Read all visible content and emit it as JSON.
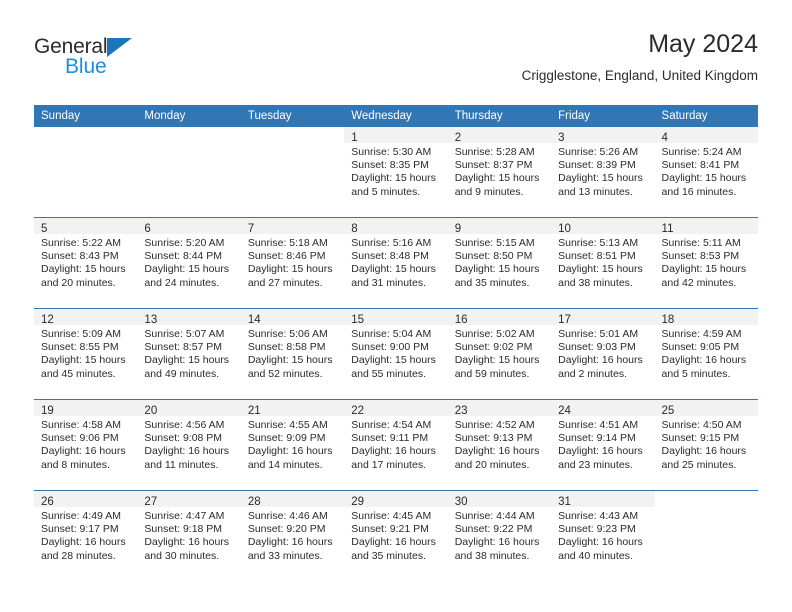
{
  "brand": {
    "name_top": "General",
    "name_bottom": "Blue",
    "triangle_color": "#1b75bb",
    "blue_text_color": "#1b8ede"
  },
  "header": {
    "month_title": "May 2024",
    "location": "Crigglestone, England, United Kingdom"
  },
  "theme": {
    "header_blue": "#3176b5",
    "daynum_band": "#f2f2f2",
    "text": "#2b2b2b"
  },
  "weekday_headers": [
    "Sunday",
    "Monday",
    "Tuesday",
    "Wednesday",
    "Thursday",
    "Friday",
    "Saturday"
  ],
  "weeks": [
    [
      {
        "day": "",
        "sunrise": "",
        "sunset": "",
        "daylight_a": "",
        "daylight_b": ""
      },
      {
        "day": "",
        "sunrise": "",
        "sunset": "",
        "daylight_a": "",
        "daylight_b": ""
      },
      {
        "day": "",
        "sunrise": "",
        "sunset": "",
        "daylight_a": "",
        "daylight_b": ""
      },
      {
        "day": "1",
        "sunrise": "Sunrise: 5:30 AM",
        "sunset": "Sunset: 8:35 PM",
        "daylight_a": "Daylight: 15 hours",
        "daylight_b": "and 5 minutes."
      },
      {
        "day": "2",
        "sunrise": "Sunrise: 5:28 AM",
        "sunset": "Sunset: 8:37 PM",
        "daylight_a": "Daylight: 15 hours",
        "daylight_b": "and 9 minutes."
      },
      {
        "day": "3",
        "sunrise": "Sunrise: 5:26 AM",
        "sunset": "Sunset: 8:39 PM",
        "daylight_a": "Daylight: 15 hours",
        "daylight_b": "and 13 minutes."
      },
      {
        "day": "4",
        "sunrise": "Sunrise: 5:24 AM",
        "sunset": "Sunset: 8:41 PM",
        "daylight_a": "Daylight: 15 hours",
        "daylight_b": "and 16 minutes."
      }
    ],
    [
      {
        "day": "5",
        "sunrise": "Sunrise: 5:22 AM",
        "sunset": "Sunset: 8:43 PM",
        "daylight_a": "Daylight: 15 hours",
        "daylight_b": "and 20 minutes."
      },
      {
        "day": "6",
        "sunrise": "Sunrise: 5:20 AM",
        "sunset": "Sunset: 8:44 PM",
        "daylight_a": "Daylight: 15 hours",
        "daylight_b": "and 24 minutes."
      },
      {
        "day": "7",
        "sunrise": "Sunrise: 5:18 AM",
        "sunset": "Sunset: 8:46 PM",
        "daylight_a": "Daylight: 15 hours",
        "daylight_b": "and 27 minutes."
      },
      {
        "day": "8",
        "sunrise": "Sunrise: 5:16 AM",
        "sunset": "Sunset: 8:48 PM",
        "daylight_a": "Daylight: 15 hours",
        "daylight_b": "and 31 minutes."
      },
      {
        "day": "9",
        "sunrise": "Sunrise: 5:15 AM",
        "sunset": "Sunset: 8:50 PM",
        "daylight_a": "Daylight: 15 hours",
        "daylight_b": "and 35 minutes."
      },
      {
        "day": "10",
        "sunrise": "Sunrise: 5:13 AM",
        "sunset": "Sunset: 8:51 PM",
        "daylight_a": "Daylight: 15 hours",
        "daylight_b": "and 38 minutes."
      },
      {
        "day": "11",
        "sunrise": "Sunrise: 5:11 AM",
        "sunset": "Sunset: 8:53 PM",
        "daylight_a": "Daylight: 15 hours",
        "daylight_b": "and 42 minutes."
      }
    ],
    [
      {
        "day": "12",
        "sunrise": "Sunrise: 5:09 AM",
        "sunset": "Sunset: 8:55 PM",
        "daylight_a": "Daylight: 15 hours",
        "daylight_b": "and 45 minutes."
      },
      {
        "day": "13",
        "sunrise": "Sunrise: 5:07 AM",
        "sunset": "Sunset: 8:57 PM",
        "daylight_a": "Daylight: 15 hours",
        "daylight_b": "and 49 minutes."
      },
      {
        "day": "14",
        "sunrise": "Sunrise: 5:06 AM",
        "sunset": "Sunset: 8:58 PM",
        "daylight_a": "Daylight: 15 hours",
        "daylight_b": "and 52 minutes."
      },
      {
        "day": "15",
        "sunrise": "Sunrise: 5:04 AM",
        "sunset": "Sunset: 9:00 PM",
        "daylight_a": "Daylight: 15 hours",
        "daylight_b": "and 55 minutes."
      },
      {
        "day": "16",
        "sunrise": "Sunrise: 5:02 AM",
        "sunset": "Sunset: 9:02 PM",
        "daylight_a": "Daylight: 15 hours",
        "daylight_b": "and 59 minutes."
      },
      {
        "day": "17",
        "sunrise": "Sunrise: 5:01 AM",
        "sunset": "Sunset: 9:03 PM",
        "daylight_a": "Daylight: 16 hours",
        "daylight_b": "and 2 minutes."
      },
      {
        "day": "18",
        "sunrise": "Sunrise: 4:59 AM",
        "sunset": "Sunset: 9:05 PM",
        "daylight_a": "Daylight: 16 hours",
        "daylight_b": "and 5 minutes."
      }
    ],
    [
      {
        "day": "19",
        "sunrise": "Sunrise: 4:58 AM",
        "sunset": "Sunset: 9:06 PM",
        "daylight_a": "Daylight: 16 hours",
        "daylight_b": "and 8 minutes."
      },
      {
        "day": "20",
        "sunrise": "Sunrise: 4:56 AM",
        "sunset": "Sunset: 9:08 PM",
        "daylight_a": "Daylight: 16 hours",
        "daylight_b": "and 11 minutes."
      },
      {
        "day": "21",
        "sunrise": "Sunrise: 4:55 AM",
        "sunset": "Sunset: 9:09 PM",
        "daylight_a": "Daylight: 16 hours",
        "daylight_b": "and 14 minutes."
      },
      {
        "day": "22",
        "sunrise": "Sunrise: 4:54 AM",
        "sunset": "Sunset: 9:11 PM",
        "daylight_a": "Daylight: 16 hours",
        "daylight_b": "and 17 minutes."
      },
      {
        "day": "23",
        "sunrise": "Sunrise: 4:52 AM",
        "sunset": "Sunset: 9:13 PM",
        "daylight_a": "Daylight: 16 hours",
        "daylight_b": "and 20 minutes."
      },
      {
        "day": "24",
        "sunrise": "Sunrise: 4:51 AM",
        "sunset": "Sunset: 9:14 PM",
        "daylight_a": "Daylight: 16 hours",
        "daylight_b": "and 23 minutes."
      },
      {
        "day": "25",
        "sunrise": "Sunrise: 4:50 AM",
        "sunset": "Sunset: 9:15 PM",
        "daylight_a": "Daylight: 16 hours",
        "daylight_b": "and 25 minutes."
      }
    ],
    [
      {
        "day": "26",
        "sunrise": "Sunrise: 4:49 AM",
        "sunset": "Sunset: 9:17 PM",
        "daylight_a": "Daylight: 16 hours",
        "daylight_b": "and 28 minutes."
      },
      {
        "day": "27",
        "sunrise": "Sunrise: 4:47 AM",
        "sunset": "Sunset: 9:18 PM",
        "daylight_a": "Daylight: 16 hours",
        "daylight_b": "and 30 minutes."
      },
      {
        "day": "28",
        "sunrise": "Sunrise: 4:46 AM",
        "sunset": "Sunset: 9:20 PM",
        "daylight_a": "Daylight: 16 hours",
        "daylight_b": "and 33 minutes."
      },
      {
        "day": "29",
        "sunrise": "Sunrise: 4:45 AM",
        "sunset": "Sunset: 9:21 PM",
        "daylight_a": "Daylight: 16 hours",
        "daylight_b": "and 35 minutes."
      },
      {
        "day": "30",
        "sunrise": "Sunrise: 4:44 AM",
        "sunset": "Sunset: 9:22 PM",
        "daylight_a": "Daylight: 16 hours",
        "daylight_b": "and 38 minutes."
      },
      {
        "day": "31",
        "sunrise": "Sunrise: 4:43 AM",
        "sunset": "Sunset: 9:23 PM",
        "daylight_a": "Daylight: 16 hours",
        "daylight_b": "and 40 minutes."
      },
      {
        "day": "",
        "sunrise": "",
        "sunset": "",
        "daylight_a": "",
        "daylight_b": ""
      }
    ]
  ]
}
